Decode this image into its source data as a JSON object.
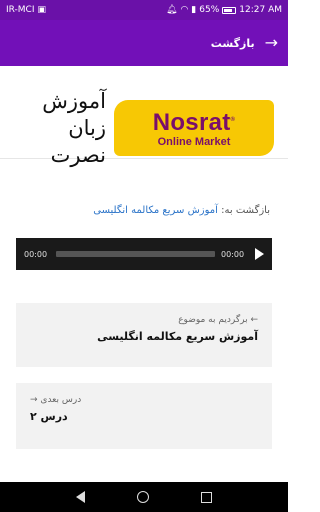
{
  "status_bar": {
    "carrier": "IR-MCI",
    "battery": "65%",
    "time": "12:27 AM"
  },
  "app_bar": {
    "title": "بازگشت",
    "back_icon": "arrow-right-icon"
  },
  "header": {
    "site_title": "آموزش زبان نصرت",
    "logo_main": "Nosrat",
    "logo_reg": "®",
    "logo_sub": "Online Market"
  },
  "backlink": {
    "prefix": "بازگشت به:",
    "link_text": "آموزش سریع مکالمه انگلیسی"
  },
  "player": {
    "current_time": "00:00",
    "duration": "00:00",
    "progress": 0
  },
  "prev_card": {
    "label": "← برگردیم به موضوع",
    "title": "آموزش سریع مکالمه انگلیسی"
  },
  "next_card": {
    "label": "درس بعدی →",
    "title": "درس ۲"
  },
  "colors": {
    "status_bar": "#6a11a8",
    "app_bar": "#7210b8",
    "logo_bg": "#f7c804",
    "logo_text": "#7a0f6b",
    "link": "#2a73c8"
  }
}
